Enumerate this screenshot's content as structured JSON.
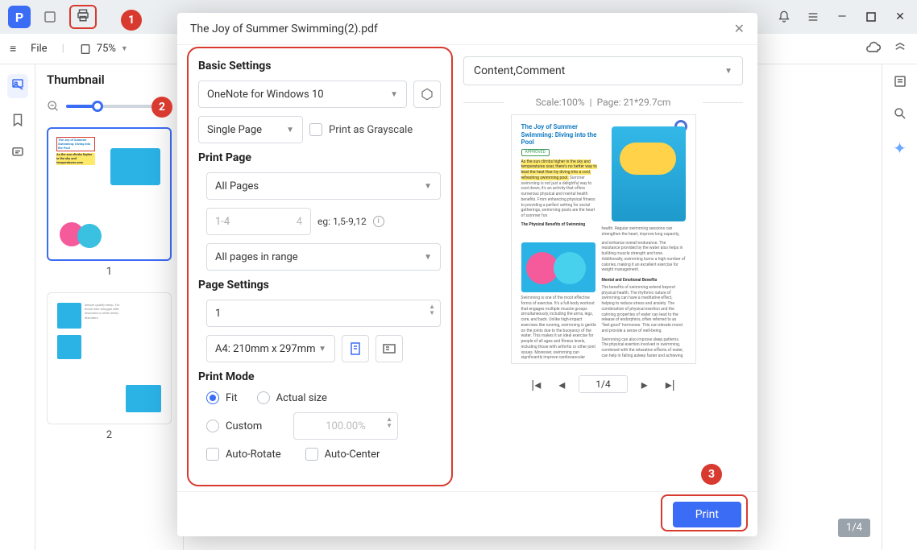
{
  "titlebar": {
    "app_initial": "P"
  },
  "menubar": {
    "file_label": "File",
    "zoom_value": "75%"
  },
  "thumbnail_panel": {
    "title": "Thumbnail",
    "page1_label": "1",
    "page2_label": "2"
  },
  "document": {
    "page_counter": "1/4"
  },
  "modal": {
    "title": "The Joy of Summer Swimming(2).pdf",
    "basic_settings": {
      "title": "Basic Settings",
      "printer": "OneNote for Windows 10",
      "page_view": "Single Page",
      "grayscale_label": "Print as Grayscale"
    },
    "print_page": {
      "title": "Print Page",
      "range_select": "All Pages",
      "range_placeholder": "1-4",
      "total_pages": "4",
      "example": "eg: 1,5-9,12",
      "pages_in_range": "All pages in range"
    },
    "page_settings": {
      "title": "Page Settings",
      "copies": "1",
      "paper": "A4: 210mm x 297mm"
    },
    "print_mode": {
      "title": "Print Mode",
      "fit_label": "Fit",
      "actual_label": "Actual size",
      "custom_label": "Custom",
      "custom_value": "100.00%",
      "auto_rotate": "Auto-Rotate",
      "auto_center": "Auto-Center"
    },
    "preview": {
      "content_select": "Content,Comment",
      "scale_label": "Scale:100%",
      "page_size_label": "Page: 21*29.7cm",
      "doc_title": "The Joy of Summer Swimming: Diving into the Pool",
      "approved": "APPROVED",
      "hl_text": "As the sun climbs higher in the sky and temperatures soar, there's no better way to beat the heat than by diving into a cool, refreshing swimming pool.",
      "regtext": " Summer swimming is not just a delightful way to cool down; it's an activity that offers numerous physical and mental health benefits. From enhancing physical fitness to providing a perfect setting for social gatherings, swimming pools are the heart of summer fun.",
      "sub1": "The Physical Benefits of Swimming",
      "para1b": "Swimming is one of the most effective forms of exercise. It's a full-body workout that engages multiple muscle groups simultaneously, including the arms, legs, core, and back. Unlike high-impact exercises like running, swimming is gentle on the joints due to the buoyancy of the water. This makes it an ideal exercise for people of all ages and fitness levels, including those with arthritis or other joint issues. Moreover, swimming can significantly improve cardiovascular",
      "col2a": "health. Regular swimming sessions can strengthen the heart, improve lung capacity,",
      "col2b": "and enhance overall endurance. The resistance provided by the water also helps in building muscle strength and tone. Additionally, swimming burns a high number of calories, making it an excellent exercise for weight management.",
      "sub2": "Mental and Emotional Benefits",
      "col2c": "The benefits of swimming extend beyond physical health. The rhythmic nature of swimming can have a meditative effect, helping to reduce stress and anxiety. The combination of physical exertion and the calming properties of water can lead to the release of endorphins, often referred to as \"feel-good\" hormones. This can elevate mood and provide a sense of well-being.",
      "col2d": "Swimming can also improve sleep patterns. The physical exertion involved in swimming, combined with the relaxation effects of water, can help in falling asleep faster and achieving",
      "pager_value": "1/4"
    },
    "print_button": "Print"
  },
  "annotations": {
    "a1": "1",
    "a2": "2",
    "a3": "3"
  }
}
